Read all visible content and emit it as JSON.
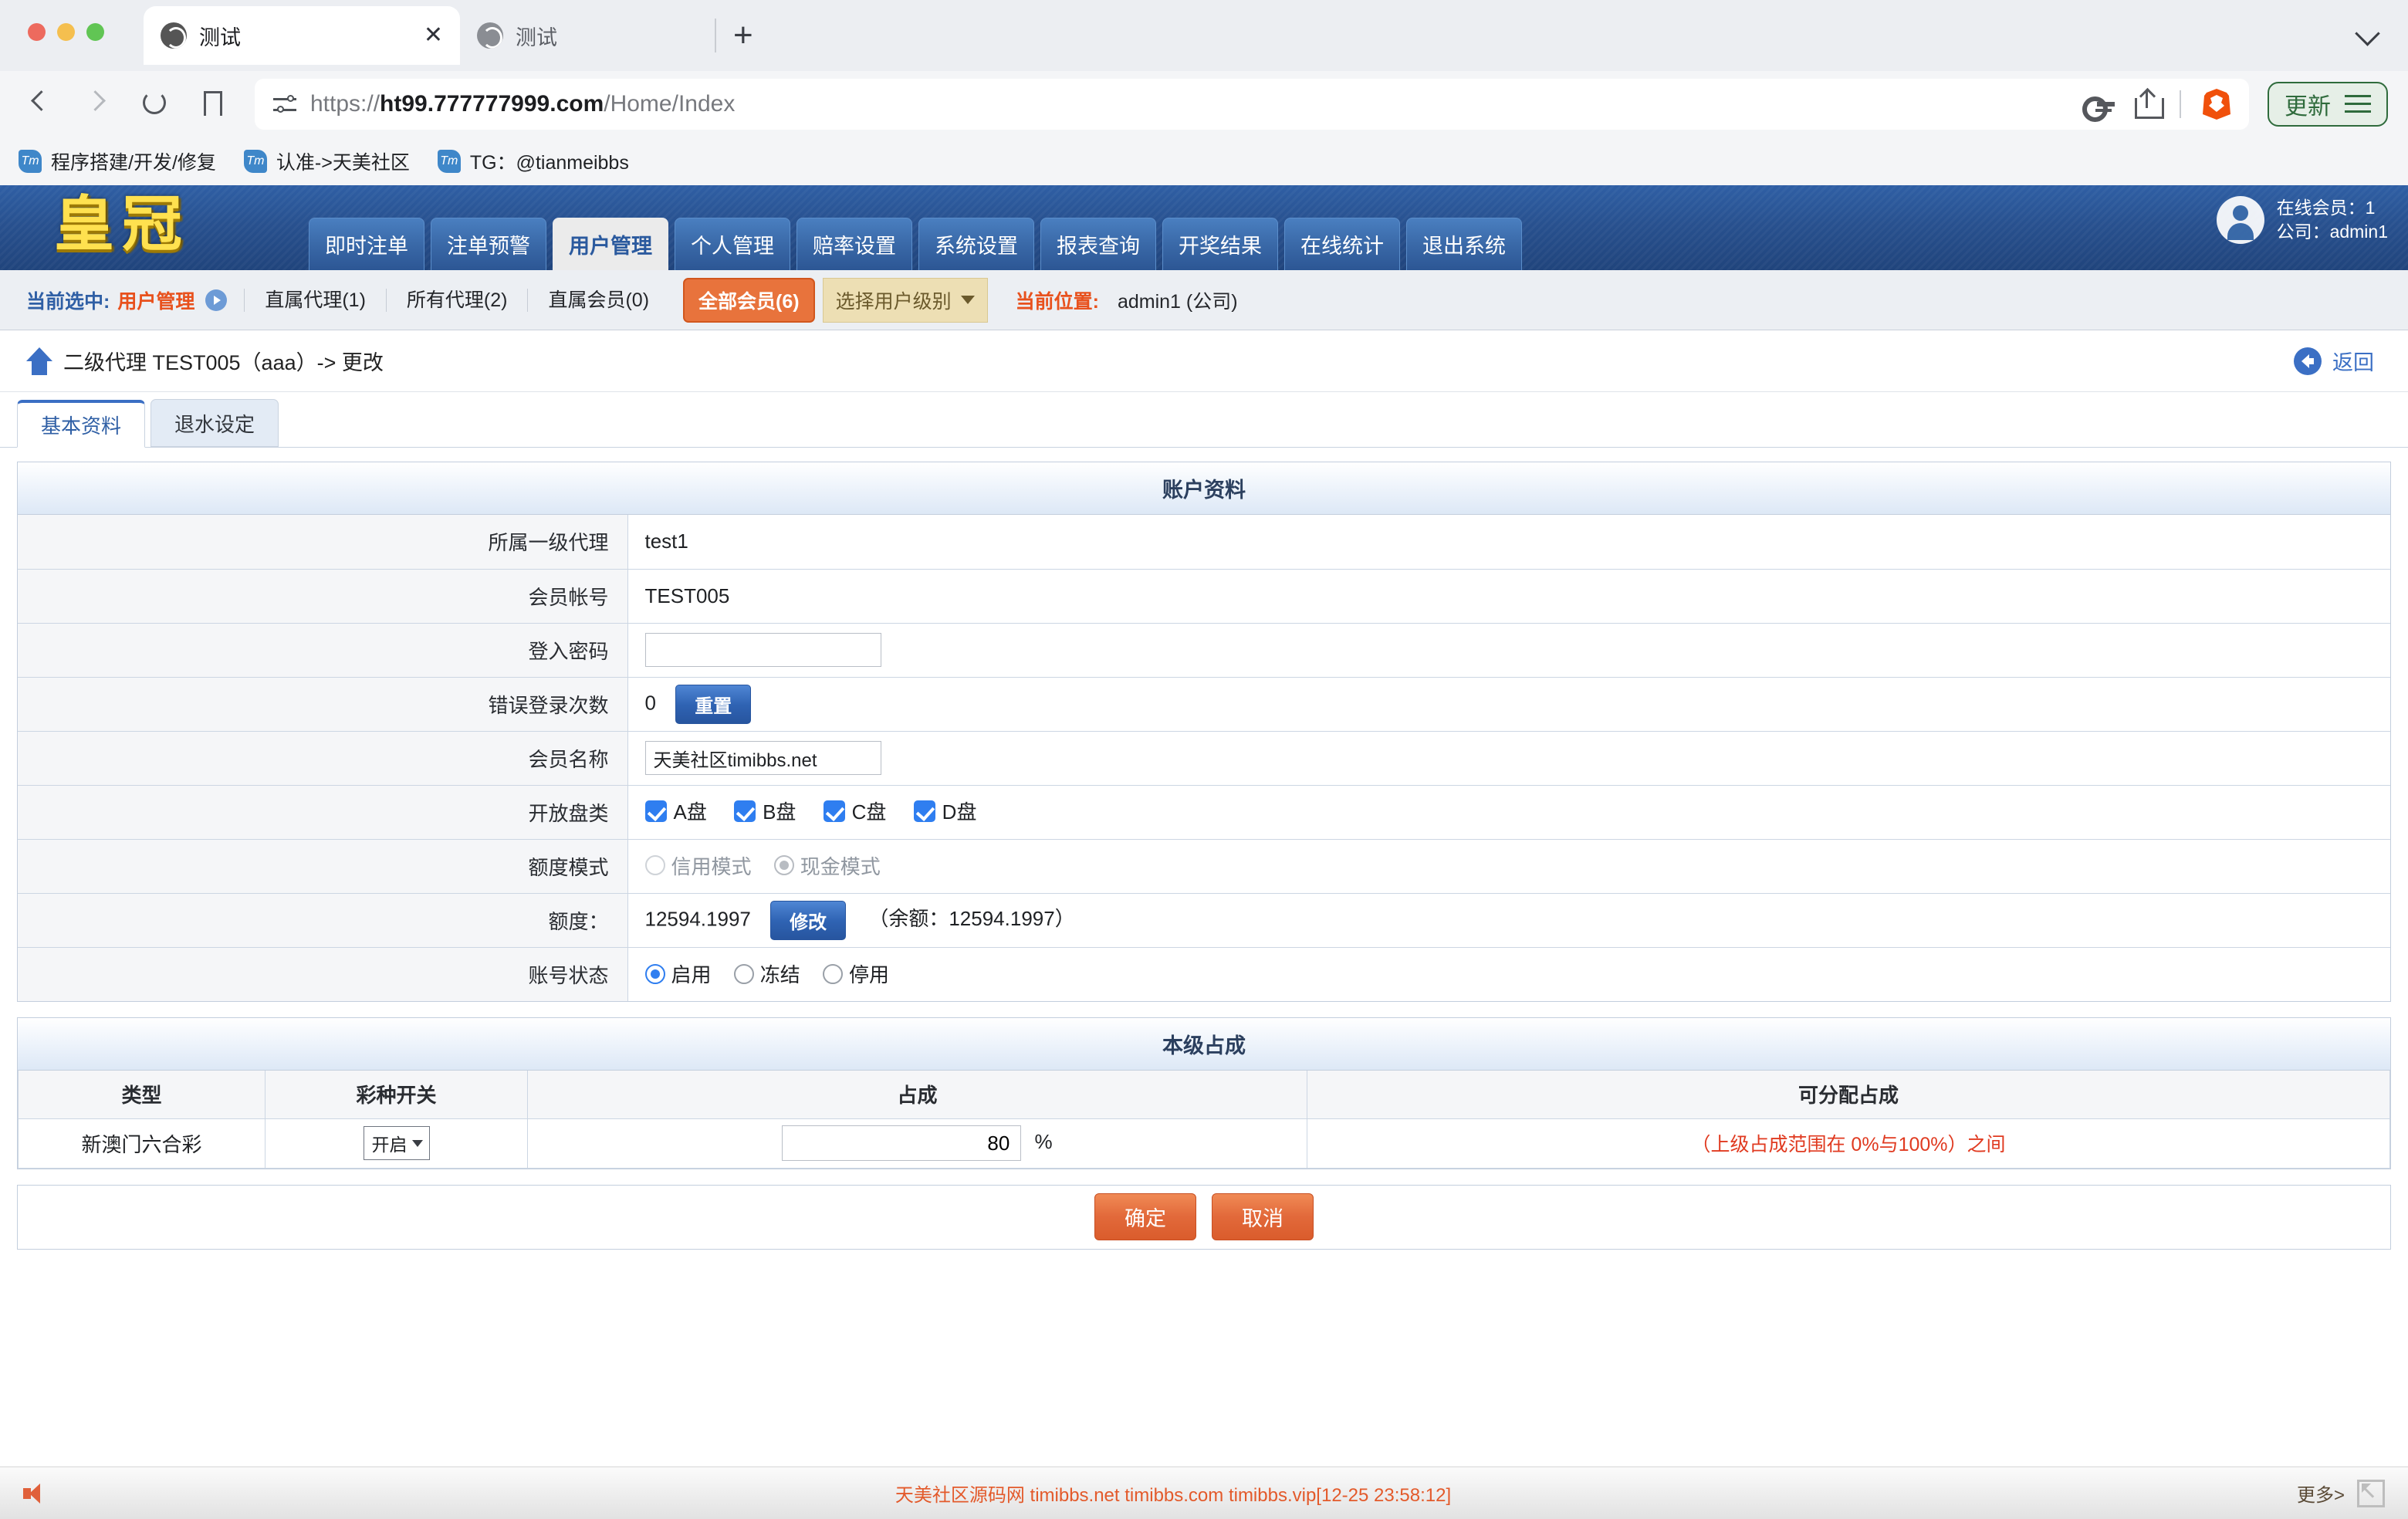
{
  "browser": {
    "tabs": [
      {
        "title": "测试",
        "active": true,
        "close_label": "✕"
      },
      {
        "title": "测试",
        "active": false
      }
    ],
    "new_tab_label": "+",
    "url_prefix": "https://",
    "url_domain": "ht99.777777999.com",
    "url_path": "/Home/Index",
    "update_button": "更新",
    "bookmarks": [
      {
        "icon_text": "Tm",
        "label": "程序搭建/开发/修复"
      },
      {
        "icon_text": "Tm",
        "label": "认准->天美社区"
      },
      {
        "icon_text": "Tm",
        "label": "TG：@tianmeibbs"
      }
    ]
  },
  "site": {
    "logo": "皇冠",
    "mainnav": [
      {
        "label": "即时注单",
        "active": false
      },
      {
        "label": "注单预警",
        "active": false
      },
      {
        "label": "用户管理",
        "active": true
      },
      {
        "label": "个人管理",
        "active": false
      },
      {
        "label": "赔率设置",
        "active": false
      },
      {
        "label": "系统设置",
        "active": false
      },
      {
        "label": "报表查询",
        "active": false
      },
      {
        "label": "开奖结果",
        "active": false
      },
      {
        "label": "在线统计",
        "active": false
      },
      {
        "label": "退出系统",
        "active": false
      }
    ],
    "user": {
      "online_members": "在线会员：1",
      "company": "公司：admin1"
    },
    "subnav": {
      "current_label": "当前选中:",
      "current_value": "用户管理",
      "items": [
        {
          "label": "直属代理(1)"
        },
        {
          "label": "所有代理(2)"
        },
        {
          "label": "直属会员(0)"
        }
      ],
      "all_members_pill": "全部会员(6)",
      "level_select": "选择用户级别",
      "position_label": "当前位置:",
      "position_value": "admin1 (公司)"
    },
    "breadcrumb": {
      "text": "二级代理 TEST005（aaa）-> 更改",
      "back_label": "返回"
    },
    "tabs": [
      {
        "label": "基本资料",
        "active": true
      },
      {
        "label": "退水设定",
        "active": false
      }
    ]
  },
  "account_card": {
    "title": "账户资料",
    "rows": {
      "parent_agent_label": "所属一级代理",
      "parent_agent_value": "test1",
      "account_label": "会员帐号",
      "account_value": "TEST005",
      "password_label": "登入密码",
      "password_value": "",
      "fail_count_label": "错误登录次数",
      "fail_count_value": "0",
      "reset_button": "重置",
      "member_name_label": "会员名称",
      "member_name_value": "天美社区timibbs.net",
      "open_types_label": "开放盘类",
      "open_types": [
        {
          "label": "A盘",
          "checked": true
        },
        {
          "label": "B盘",
          "checked": true
        },
        {
          "label": "C盘",
          "checked": true
        },
        {
          "label": "D盘",
          "checked": true
        }
      ],
      "credit_mode_label": "额度模式",
      "credit_modes": [
        {
          "label": "信用模式",
          "selected": false
        },
        {
          "label": "现金模式",
          "selected": true
        }
      ],
      "quota_label": "额度：",
      "quota_value": "12594.1997",
      "quota_edit_button": "修改",
      "quota_balance": "（余额：12594.1997）",
      "status_label": "账号状态",
      "statuses": [
        {
          "label": "启用",
          "selected": true
        },
        {
          "label": "冻结",
          "selected": false
        },
        {
          "label": "停用",
          "selected": false
        }
      ]
    }
  },
  "share_card": {
    "title": "本级占成",
    "columns": [
      "类型",
      "彩种开关",
      "占成",
      "可分配占成"
    ],
    "rows": [
      {
        "type": "新澳门六合彩",
        "switch": "开启",
        "share": "80",
        "percent_sign": "%",
        "allocatable": "（上级占成范围在 0%与100%）之间"
      }
    ]
  },
  "actions": {
    "confirm": "确定",
    "cancel": "取消"
  },
  "footer": {
    "text": "天美社区源码网 timibbs.net timibbs.com timibbs.vip[12-25 23:58:12]",
    "more": "更多>"
  }
}
